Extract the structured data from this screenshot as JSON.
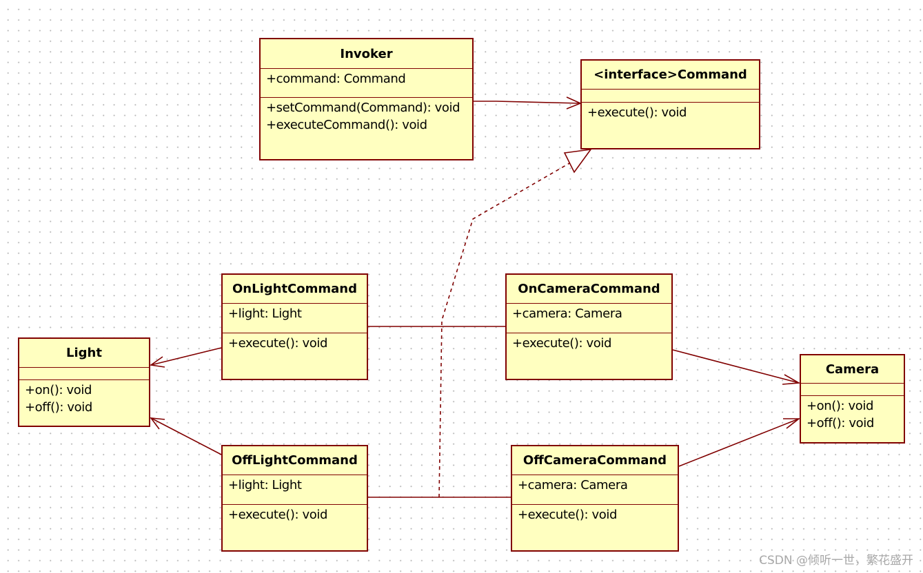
{
  "diagram": {
    "classes": [
      {
        "id": "invoker",
        "name": "Invoker",
        "attributes": [
          "+command: Command"
        ],
        "operations": [
          "+setCommand(Command): void",
          "+executeCommand(): void"
        ]
      },
      {
        "id": "command",
        "name": "<interface>Command",
        "attributes": [],
        "operations": [
          "+execute(): void"
        ]
      },
      {
        "id": "on-light-command",
        "name": "OnLightCommand",
        "attributes": [
          "+light: Light"
        ],
        "operations": [
          "+execute(): void"
        ]
      },
      {
        "id": "on-camera-command",
        "name": "OnCameraCommand",
        "attributes": [
          "+camera: Camera"
        ],
        "operations": [
          "+execute(): void"
        ]
      },
      {
        "id": "light",
        "name": "Light",
        "attributes": [],
        "operations": [
          "+on(): void",
          "+off(): void"
        ]
      },
      {
        "id": "camera",
        "name": "Camera",
        "attributes": [],
        "operations": [
          "+on(): void",
          "+off(): void"
        ]
      },
      {
        "id": "off-light-command",
        "name": "OffLightCommand",
        "attributes": [
          "+light: Light"
        ],
        "operations": [
          "+execute(): void"
        ]
      },
      {
        "id": "off-camera-command",
        "name": "OffCameraCommand",
        "attributes": [
          "+camera: Camera"
        ],
        "operations": [
          "+execute(): void"
        ]
      }
    ],
    "relations": [
      {
        "from": "Invoker",
        "to": "<interface>Command",
        "type": "association"
      },
      {
        "from": "OnLightCommand",
        "to": "<interface>Command",
        "type": "realization"
      },
      {
        "from": "OnCameraCommand",
        "to": "<interface>Command",
        "type": "realization"
      },
      {
        "from": "OffLightCommand",
        "to": "<interface>Command",
        "type": "realization"
      },
      {
        "from": "OffCameraCommand",
        "to": "<interface>Command",
        "type": "realization"
      },
      {
        "from": "OnLightCommand",
        "to": "Light",
        "type": "association"
      },
      {
        "from": "OffLightCommand",
        "to": "Light",
        "type": "association"
      },
      {
        "from": "OnCameraCommand",
        "to": "Camera",
        "type": "association"
      },
      {
        "from": "OffCameraCommand",
        "to": "Camera",
        "type": "association"
      }
    ],
    "colors": {
      "fill": "#ffffc0",
      "border": "#800000"
    }
  },
  "watermark": "CSDN @倾听一世，繁花盛开"
}
